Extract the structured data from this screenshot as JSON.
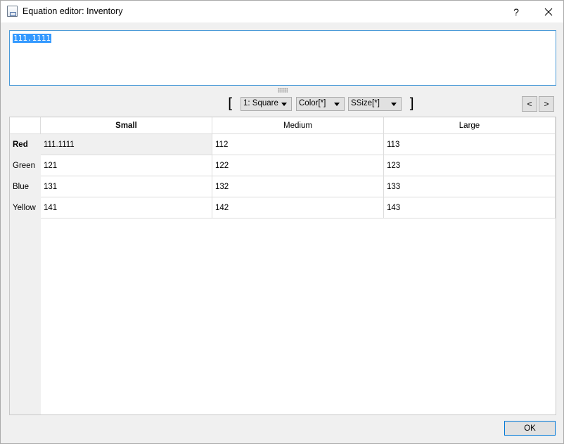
{
  "window": {
    "title": "Equation editor: Inventory",
    "help_label": "?",
    "icons": {
      "app": "equation-editor-icon",
      "close": "close-icon"
    }
  },
  "editor": {
    "value": "111.1111",
    "selected": true
  },
  "toolbar": {
    "open_bracket": "[",
    "close_bracket": "]",
    "shape_combo": "1: Square",
    "color_combo": "Color[*]",
    "size_combo": "SSize[*]",
    "prev_label": "<",
    "next_label": ">"
  },
  "grid": {
    "columns": [
      "Small",
      "Medium",
      "Large"
    ],
    "active_column": 0,
    "active_row": 0,
    "rows": [
      {
        "label": "Red",
        "values": [
          "111.1111",
          "112",
          "113"
        ]
      },
      {
        "label": "Green",
        "values": [
          "121",
          "122",
          "123"
        ]
      },
      {
        "label": "Blue",
        "values": [
          "131",
          "132",
          "133"
        ]
      },
      {
        "label": "Yellow",
        "values": [
          "141",
          "142",
          "143"
        ]
      }
    ]
  },
  "footer": {
    "ok_label": "OK"
  },
  "colors": {
    "focus_border": "#4a9ad8",
    "selection": "#3399ff",
    "default_button_border": "#0078d7"
  }
}
